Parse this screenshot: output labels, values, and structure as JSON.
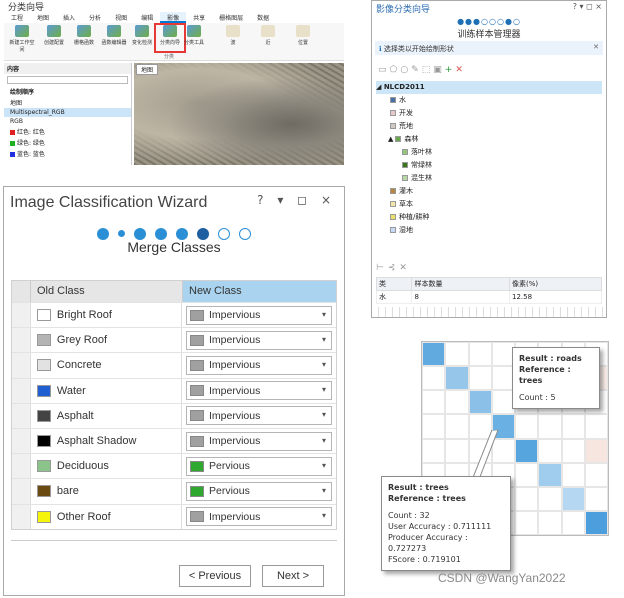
{
  "ribbon_caption": "分类向导",
  "ribbon": {
    "tabs": [
      "工程",
      "地图",
      "插入",
      "分析",
      "视图",
      "编辑",
      "影像",
      "共享",
      "栅格图层",
      "数据"
    ],
    "active_tab": "影像",
    "buttons": [
      {
        "label": "新建工作空间"
      },
      {
        "label": "创建配置"
      },
      {
        "label": "栅格函数"
      },
      {
        "label": "函数编辑器"
      },
      {
        "label": "变化检测"
      },
      {
        "label": "分类向导"
      },
      {
        "label": "分类工具"
      }
    ],
    "groups": [
      "分类"
    ],
    "legend_labels": [
      "波",
      "近",
      "位置"
    ]
  },
  "contents_panel": {
    "header": "内容",
    "search_placeholder": "搜索",
    "section": "绘制顺序",
    "map_item": "地图",
    "layer": "Multispectral_RGB",
    "rgb_label": "RGB",
    "bands": [
      {
        "label": "红色: 红色",
        "color": "#e02020"
      },
      {
        "label": "绿色: 绿色",
        "color": "#20b020"
      },
      {
        "label": "蓝色: 蓝色",
        "color": "#2030e0"
      }
    ],
    "map_tab": "地图"
  },
  "cn_wizard": {
    "title": "影像分类向导",
    "controls": "? ▾ ◻ ×",
    "steps": "●●●○○○●○",
    "subtitle": "训练样本管理器",
    "info": "选择类以开始绘制形状",
    "root": "NLCD2011",
    "items": [
      {
        "label": "水",
        "color": "#4a6fa8",
        "indent": 1
      },
      {
        "label": "开发",
        "color": "#e6c9c9",
        "indent": 1
      },
      {
        "label": "荒地",
        "color": "#cfcac3",
        "indent": 1
      },
      {
        "label": "森林",
        "color": "#6aa84f",
        "indent": 1,
        "expand": "▲"
      },
      {
        "label": "落叶林",
        "color": "#93c47d",
        "indent": 2
      },
      {
        "label": "常绿林",
        "color": "#38761d",
        "indent": 2
      },
      {
        "label": "混生林",
        "color": "#b6d7a8",
        "indent": 2
      },
      {
        "label": "灌木",
        "color": "#b5893d",
        "indent": 1
      },
      {
        "label": "草本",
        "color": "#f1e8a8",
        "indent": 1
      },
      {
        "label": "种植/耕种",
        "color": "#ece06a",
        "indent": 1
      },
      {
        "label": "湿地",
        "color": "#c9daf8",
        "indent": 1
      }
    ],
    "table": {
      "headers": [
        "类",
        "样本数量",
        "像素(%)"
      ],
      "rows": [
        [
          "水",
          "8",
          "12.58"
        ]
      ]
    }
  },
  "wizard": {
    "title": "Image Classification Wizard",
    "controls": "? ▾ ◻ ×",
    "subtitle": "Merge Classes",
    "headers": {
      "old": "Old Class",
      "new": "New Class"
    },
    "rows": [
      {
        "old": "Bright Roof",
        "old_color": "#ffffff",
        "new": "Impervious",
        "new_color": "#a0a0a0"
      },
      {
        "old": "Grey Roof",
        "old_color": "#b4b4b4",
        "new": "Impervious",
        "new_color": "#a0a0a0"
      },
      {
        "old": "Concrete",
        "old_color": "#e2e2e2",
        "new": "Impervious",
        "new_color": "#a0a0a0"
      },
      {
        "old": "Water",
        "old_color": "#1f5fd1",
        "new": "Impervious",
        "new_color": "#a0a0a0"
      },
      {
        "old": "Asphalt",
        "old_color": "#444444",
        "new": "Impervious",
        "new_color": "#a0a0a0"
      },
      {
        "old": "Asphalt Shadow",
        "old_color": "#000000",
        "new": "Impervious",
        "new_color": "#a0a0a0"
      },
      {
        "old": "Deciduous",
        "old_color": "#8bc48a",
        "new": "Pervious",
        "new_color": "#2ea82e"
      },
      {
        "old": "bare",
        "old_color": "#6b4a12",
        "new": "Pervious",
        "new_color": "#2ea82e"
      },
      {
        "old": "Other Roof",
        "old_color": "#f5f50a",
        "new": "Impervious",
        "new_color": "#a0a0a0"
      }
    ],
    "prev_label": "< Previous",
    "next_label": "Next >"
  },
  "confusion_matrix": {
    "cells": [
      [
        0.75,
        0,
        0,
        0,
        0,
        0,
        0,
        0
      ],
      [
        0,
        0.5,
        0,
        0,
        0,
        0,
        0,
        0
      ],
      [
        0,
        0,
        0.55,
        0,
        0,
        0,
        0,
        0
      ],
      [
        0,
        0,
        0,
        0.7,
        0,
        0,
        0,
        0
      ],
      [
        0,
        0,
        0,
        0,
        0.8,
        0,
        0,
        0.08
      ],
      [
        0,
        0,
        0,
        0,
        0,
        0.45,
        0,
        0
      ],
      [
        0,
        0,
        0,
        0,
        0,
        0,
        0.35,
        0
      ],
      [
        0,
        0,
        0,
        0,
        0,
        0,
        0,
        0.85
      ]
    ],
    "tooltip_top": {
      "result": "Result : roads",
      "reference": "Reference : trees",
      "count": "Count : 5"
    },
    "tooltip_bottom": {
      "result": "Result : trees",
      "reference": "Reference : trees",
      "count": "Count : 32",
      "user_accuracy": "User Accuracy : 0.711111",
      "producer_accuracy": "Producer Accuracy : 0.727273",
      "fscore": "FScore : 0.719101"
    }
  },
  "watermark": "CSDN @WangYan2022"
}
